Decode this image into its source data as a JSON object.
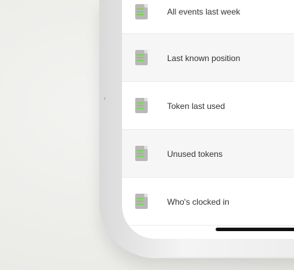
{
  "reports": {
    "items": [
      {
        "label": "All events last week",
        "icon": "report-doc-icon"
      },
      {
        "label": "Last known position",
        "icon": "report-doc-icon"
      },
      {
        "label": "Token last used",
        "icon": "report-doc-icon"
      },
      {
        "label": "Unused tokens",
        "icon": "report-doc-icon"
      },
      {
        "label": "Who's clocked in",
        "icon": "report-doc-icon"
      }
    ]
  },
  "colors": {
    "icon_gray": "#b8b8b8",
    "icon_lines_green": "#7fcf5e",
    "row_shade": "#f6f6f6"
  }
}
